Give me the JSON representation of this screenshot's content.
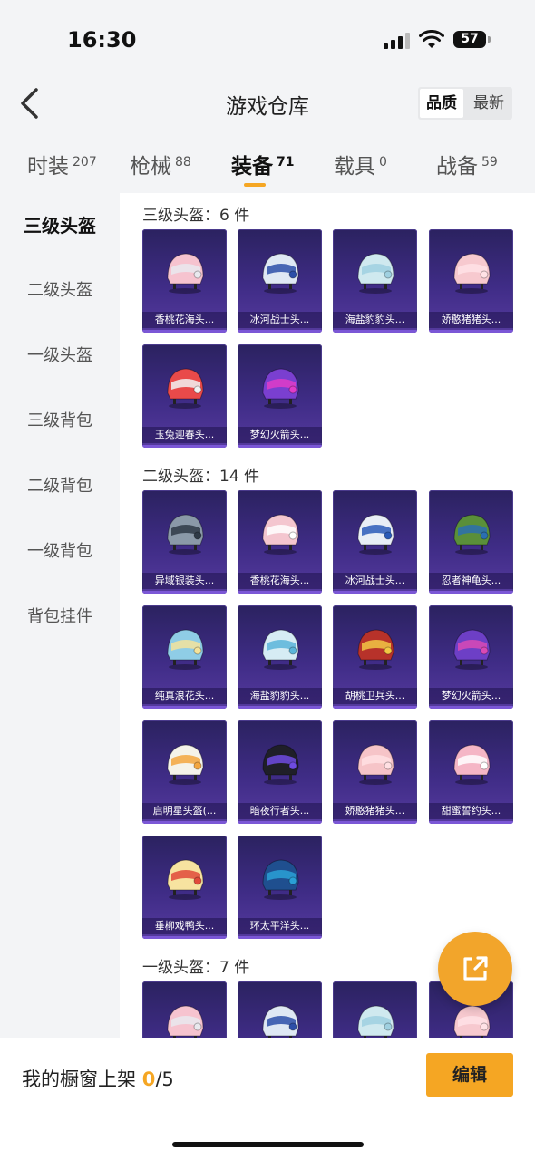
{
  "status": {
    "time": "16:30",
    "battery": "57"
  },
  "header": {
    "title": "游戏仓库",
    "sort": [
      "品质",
      "最新"
    ]
  },
  "tabs": [
    {
      "label": "时装",
      "count": "207"
    },
    {
      "label": "枪械",
      "count": "88"
    },
    {
      "label": "装备",
      "count": "71"
    },
    {
      "label": "载具",
      "count": "0"
    },
    {
      "label": "战备",
      "count": "59"
    }
  ],
  "sidebar": [
    "三级头盔",
    "二级头盔",
    "一级头盔",
    "三级背包",
    "二级背包",
    "一级背包",
    "背包挂件"
  ],
  "sections": [
    {
      "title": "三级头盔：6 件",
      "items": [
        "香桃花海头...",
        "冰河战士头...",
        "海盐豹豹头...",
        "娇憨猪猪头...",
        "玉兔迎春头...",
        "梦幻火箭头..."
      ]
    },
    {
      "title": "二级头盔：14 件",
      "items": [
        "异域银装头...",
        "香桃花海头...",
        "冰河战士头...",
        "忍者神龟头...",
        "纯真浪花头...",
        "海盐豹豹头...",
        "胡桃卫兵头...",
        "梦幻火箭头...",
        "启明星头盔(...",
        "暗夜行者头...",
        "娇憨猪猪头...",
        "甜蜜誓约头...",
        "垂柳戏鸭头...",
        "环太平洋头..."
      ]
    },
    {
      "title": "一级头盔：7 件",
      "items": [
        "",
        "",
        "",
        ""
      ]
    }
  ],
  "bottom": {
    "label": "我的橱窗上架",
    "current": "0",
    "total": "/5",
    "edit": "编辑"
  },
  "colors": {
    "accent": "#f5a623",
    "card_bg": "#3f2c86"
  }
}
